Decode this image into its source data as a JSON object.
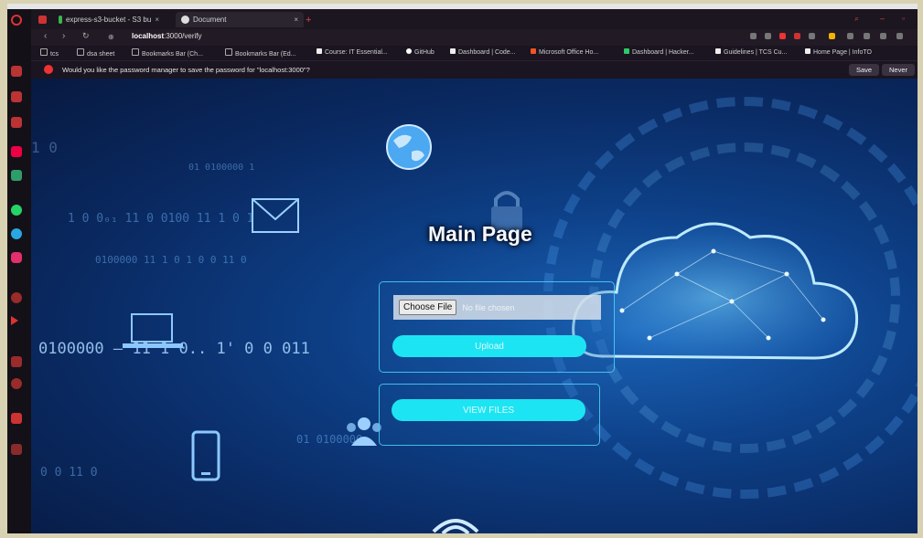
{
  "tabs": [
    {
      "label": "express-s3-bucket - S3 bu"
    },
    {
      "label": "Document"
    }
  ],
  "address": {
    "host": "localhost",
    "path": ":3000/verify"
  },
  "bookmarks": [
    {
      "label": "tcs"
    },
    {
      "label": "dsa sheet"
    },
    {
      "label": "Bookmarks Bar (Ch..."
    },
    {
      "label": "Bookmarks Bar (Ed..."
    },
    {
      "label": "Course: IT Essential..."
    },
    {
      "label": "GitHub"
    },
    {
      "label": "Dashboard | Code..."
    },
    {
      "label": "Microsoft Office Ho..."
    },
    {
      "label": "Dashboard | Hacker..."
    },
    {
      "label": "Guidelines | TCS Cu..."
    },
    {
      "label": "Home Page | InfoTO"
    }
  ],
  "password_bar": {
    "message": "Would you like the password manager to save the password for \"localhost:3000\"?",
    "save_label": "Save",
    "never_label": "Never"
  },
  "page": {
    "title": "Main Page",
    "choose_file_label": "Choose File",
    "no_file_text": "No file chosen",
    "upload_label": "Upload",
    "view_files_label": "VIEW FILES"
  },
  "background": {
    "bits_line1": "1 0",
    "bits_line2": "01        0100000        1",
    "bits_line3": "1    0 0₀₁ 11  0  0100     11    1 0      1",
    "bits_line4": "0100000      11   1  0      1    0  0   11  0",
    "bits_big": "0100000  — 11   1  0..   1'    0  0  011",
    "bits_line6": "0 0  11 0",
    "bits_line7": "01      0100000",
    "bits_small1": "01",
    "bits_small2": "0100000"
  },
  "colors": {
    "accent_cyan": "#1de4f2",
    "page_blue": "#0d3f86",
    "panel_border": "#50dcff"
  }
}
